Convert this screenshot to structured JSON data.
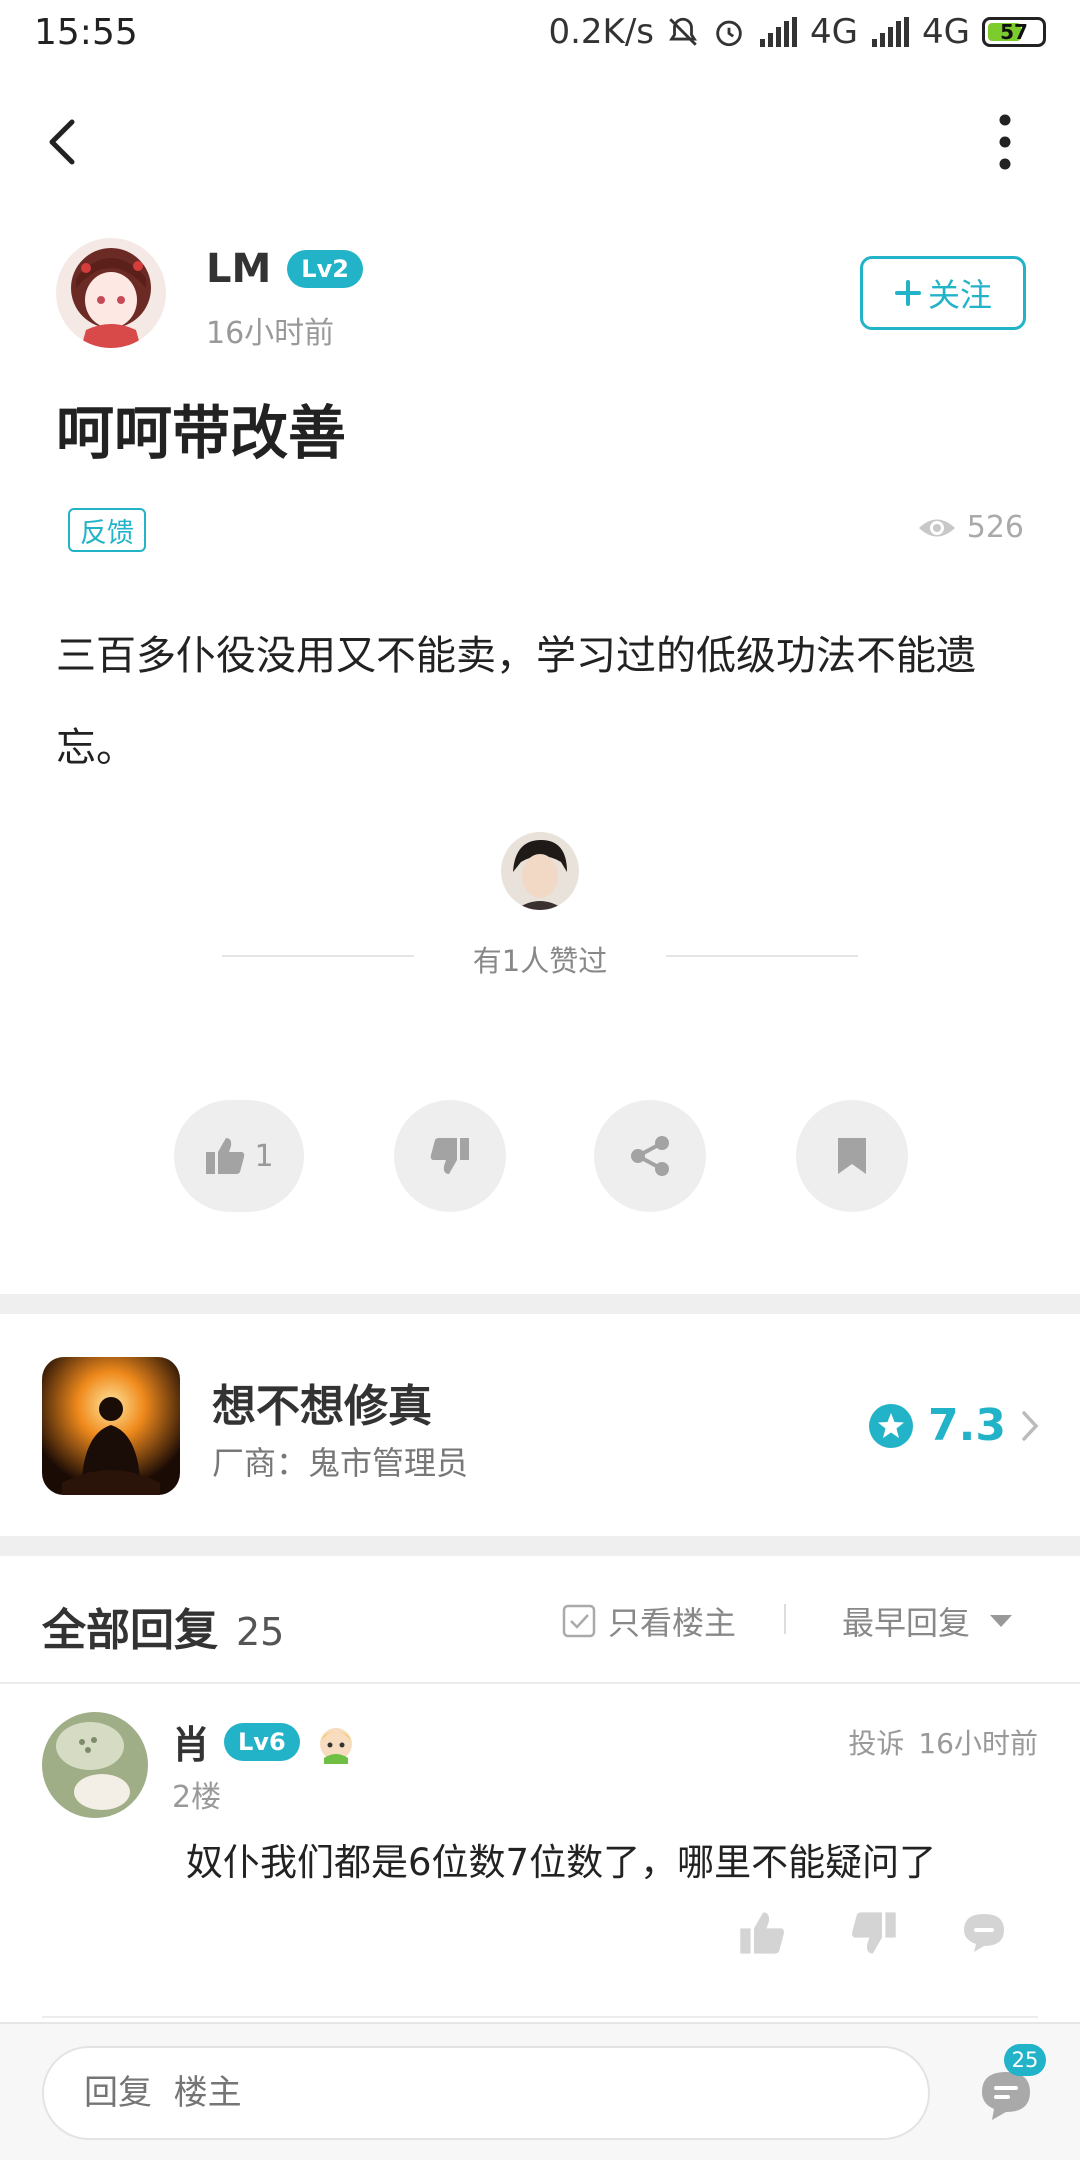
{
  "status_bar": {
    "time": "15:55",
    "speed": "0.2K/s",
    "net1": "4G",
    "net2": "4G",
    "battery": "57",
    "battery_level_percent": 57
  },
  "post": {
    "author": {
      "name": "LM",
      "level": "Lv2",
      "time": "16小时前",
      "follow_label": "关注"
    },
    "title": "呵呵带改善",
    "tag": "反馈",
    "views": "526",
    "body": "三百多仆役没用又不能卖，学习过的低级功法不能遗忘。",
    "likes_text": "有1人赞过",
    "actions": {
      "like_count": "1"
    }
  },
  "game": {
    "name": "想不想修真",
    "vendor": "厂商：鬼市管理员",
    "rating": "7.3"
  },
  "replies": {
    "title": "全部回复",
    "count": "25",
    "only_op": "只看楼主",
    "sort": "最早回复"
  },
  "comment": {
    "name": "肖",
    "level": "Lv6",
    "floor": "2楼",
    "report": "投诉",
    "time": "16小时前",
    "text": "奴仆我们都是6位数7位数了，哪里不能疑问了"
  },
  "bottom_bar": {
    "placeholder": "回复  楼主",
    "comment_badge": "25"
  },
  "colors": {
    "accent": "#23b3c8",
    "battery": "#7dcc2e"
  }
}
